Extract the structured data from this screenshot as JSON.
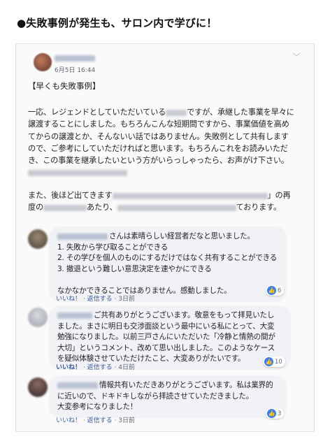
{
  "heading": "●失敗事例が発生も、サロン内で学びに！",
  "post": {
    "date": "6月5日 16:44",
    "title": "【早くも失敗事例】",
    "body": [
      {
        "a": "一応、レジェンドとしていただいている",
        "b": "ですが、承継した事業を早々に"
      },
      {
        "a": "譲渡することにしました。もちろんこんな短期間ですから、事業価値を高め"
      },
      {
        "a": "てからの譲渡とか、そんないい話ではありません。失敗例として共有します"
      },
      {
        "a": "ので、ご参考にしていただければと思います。もちろんこれをお読みいただ"
      },
      {
        "a": "き、この事業を継承したいという方がいらっしゃったら、お声がけ下さい。"
      }
    ],
    "tail": [
      {
        "a": "また、後ほど出てきます",
        "b": "」の再"
      },
      {
        "a": "度の",
        "b": "あたり、",
        "c": "ております。"
      }
    ],
    "more_icon": "chevron-down-icon"
  },
  "comments": [
    {
      "lines": [
        "さんは素晴らしい経営者だなと思いました。",
        "1. 失敗から学び取ることができる",
        "2. その学びを個人のものにするだけではなく共有することができる",
        "3. 撤退という難しい意思決定を速やかにできる",
        "",
        "なかなかできることではありません。感動しました。"
      ],
      "like": "いいね！",
      "reply": "返信する",
      "time": "3日前",
      "reactions": "6"
    },
    {
      "lines": [
        "ご共有ありがとうございます。敬意をもって拝見いたし",
        "ました。まさに明日も交渉面談という最中にいる私にとって、大変",
        "勉強になりました。以前三戸さんにいただいた「冷静と情熱の間が",
        "大切」というコメント、改めて思い出しました。このようなケース",
        "を疑似体験させていただけたこと、大変ありがたいです。"
      ],
      "like": "いいね！",
      "reply": "返信する",
      "time": "4日前",
      "reactions": "10"
    },
    {
      "lines": [
        "情報共有いただきありがとうございます。私は業界的",
        "に近いので、ドキドキしながら拝読させていただきました。",
        "大変参考になりました！"
      ],
      "like": "いいね！",
      "reply": "返信する",
      "time": "3日前",
      "reactions": "3"
    }
  ]
}
